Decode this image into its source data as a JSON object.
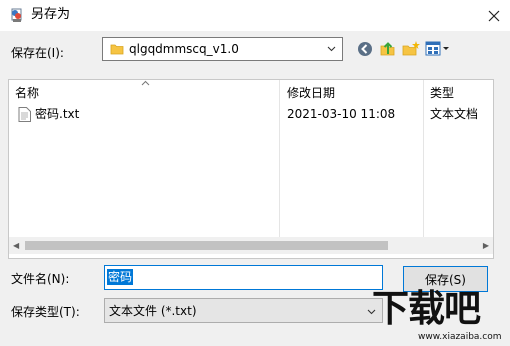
{
  "window": {
    "title": "另存为",
    "close_icon": "close-icon"
  },
  "toolbar": {
    "save_in_label": "保存在(I):",
    "folder": "qlgqdmmscq_v1.0",
    "icons": [
      "back-icon",
      "up-folder-icon",
      "new-folder-icon",
      "view-menu-icon"
    ]
  },
  "list": {
    "columns": [
      "名称",
      "修改日期",
      "类型"
    ],
    "rows": [
      {
        "name": "密码.txt",
        "modified": "2021-03-10 11:08",
        "type": "文本文档"
      }
    ]
  },
  "form": {
    "filename_label": "文件名(N):",
    "filename_value": "密码",
    "filetype_label": "保存类型(T):",
    "filetype_value": "文本文件 (*.txt)",
    "save_button": "保存(S)"
  },
  "watermark": {
    "text": "下载吧",
    "url": "www.xiazaiba.com"
  },
  "colors": {
    "accent": "#0078d7",
    "folder": "#f6c443"
  }
}
